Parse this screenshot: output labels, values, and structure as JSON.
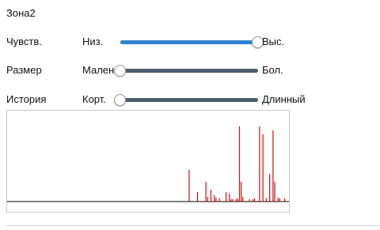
{
  "zone_title": "Зона2",
  "sliders": [
    {
      "id": "sensitivity",
      "label": "Чувств.",
      "min_label": "Низ.",
      "max_label": "Выс.",
      "value": 1.0
    },
    {
      "id": "size",
      "label": "Размер",
      "min_label": "Мален",
      "max_label": "Бол.",
      "value": 0.0
    },
    {
      "id": "history",
      "label": "История",
      "min_label": "Корт.",
      "max_label": "Длинный",
      "value": 0.0
    }
  ],
  "colors": {
    "track": "#4e5e6d",
    "track_fill": "#2f84cf",
    "bars": "#cc1111",
    "baseline": "#000000"
  },
  "chart_data": {
    "type": "bar",
    "title": "",
    "xlabel": "",
    "ylabel": "",
    "ylim": [
      0,
      1
    ],
    "grid": false,
    "values": [
      0,
      0,
      0,
      0,
      0,
      0,
      0,
      0,
      0,
      0,
      0,
      0,
      0,
      0,
      0,
      0,
      0,
      0,
      0,
      0,
      0,
      0,
      0,
      0,
      0,
      0,
      0,
      0,
      0,
      0,
      0,
      0,
      0,
      0,
      0,
      0,
      0,
      0,
      0,
      0,
      0,
      0,
      0,
      0,
      0,
      0,
      0,
      0,
      0,
      0,
      0,
      0,
      0,
      0,
      0,
      0,
      0,
      0,
      0,
      0,
      0,
      0,
      0,
      0,
      0,
      0,
      0,
      0,
      0,
      0,
      0,
      0,
      0,
      0,
      0,
      0,
      0,
      0,
      0,
      0,
      0,
      0,
      0,
      0,
      0,
      0,
      0,
      0,
      0,
      0,
      0,
      0,
      0,
      0,
      0,
      0,
      0,
      0,
      0,
      0,
      0,
      0,
      0,
      0,
      0,
      0,
      0,
      0,
      0.4,
      0,
      0,
      0,
      0,
      0.12,
      0,
      0,
      0,
      0,
      0.25,
      0.06,
      0,
      0.15,
      0,
      0.08,
      0.05,
      0,
      0.04,
      0,
      0,
      0,
      0.12,
      0,
      0.1,
      0.03,
      0.03,
      0,
      0.03,
      0.04,
      0.95,
      0.25,
      0.06,
      0,
      0,
      0,
      0.03,
      0,
      0.03,
      0.04,
      0,
      0,
      0.95,
      0,
      0.85,
      0,
      0.04,
      0,
      0.35,
      0,
      0.9,
      0.25,
      0,
      0.05,
      0.04,
      0,
      0,
      0.04,
      0,
      0
    ]
  }
}
